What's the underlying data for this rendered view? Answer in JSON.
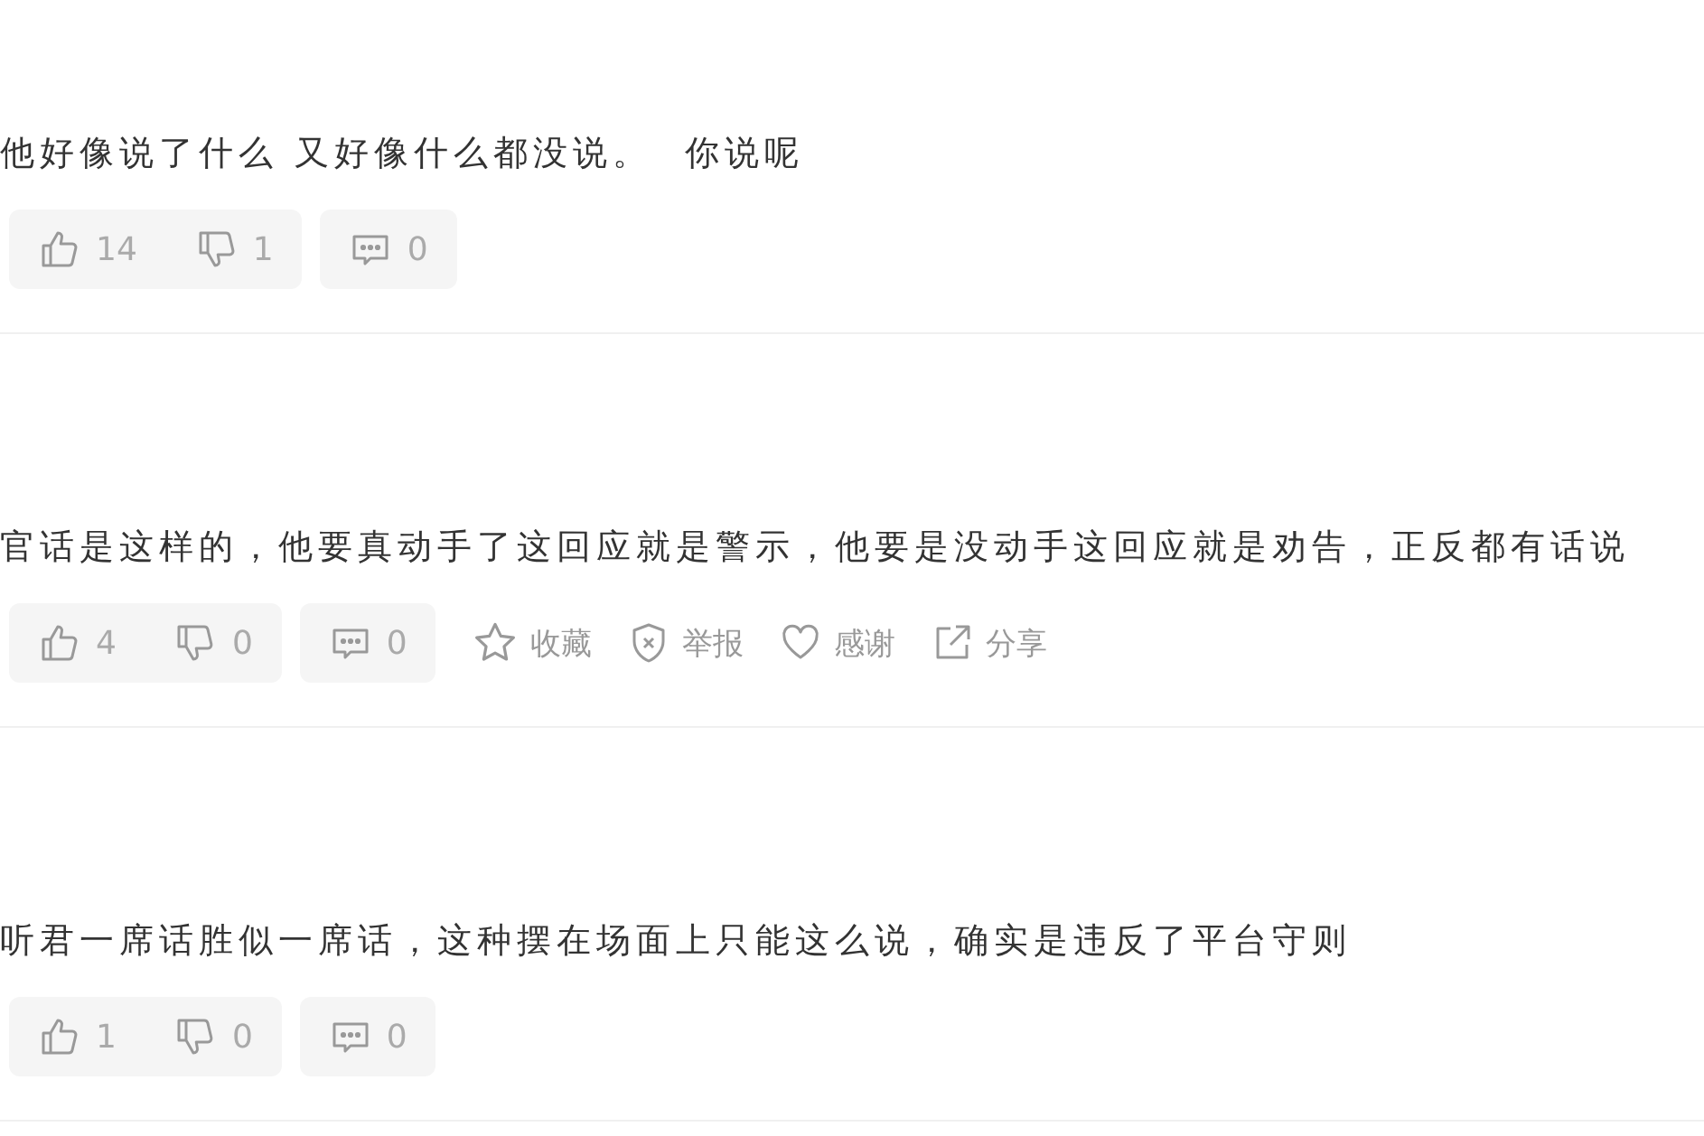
{
  "comments": [
    {
      "text": "他好像说了什么 又好像什么都没说。  你说呢",
      "likes": "14",
      "dislikes": "1",
      "replies": "0"
    },
    {
      "text": "官话是这样的，他要真动手了这回应就是警示，他要是没动手这回应就是劝告，正反都有话说",
      "likes": "4",
      "dislikes": "0",
      "replies": "0",
      "actions": [
        {
          "kind": "favorite",
          "label": "收藏"
        },
        {
          "kind": "report",
          "label": "举报"
        },
        {
          "kind": "thanks",
          "label": "感谢"
        },
        {
          "kind": "share",
          "label": "分享"
        }
      ]
    },
    {
      "text": "听君一席话胜似一席话，这种摆在场面上只能这么说，确实是违反了平台守则",
      "likes": "1",
      "dislikes": "0",
      "replies": "0"
    }
  ]
}
